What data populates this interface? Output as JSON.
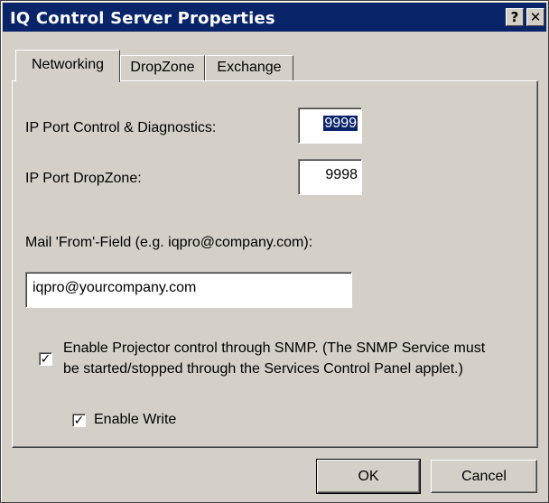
{
  "window": {
    "title": "IQ Control Server Properties",
    "help_glyph": "?",
    "close_glyph": "✕"
  },
  "tabs": [
    {
      "label": "Networking",
      "active": true
    },
    {
      "label": "DropZone",
      "active": false
    },
    {
      "label": "Exchange",
      "active": false
    }
  ],
  "networking": {
    "port_control_label": "IP Port Control & Diagnostics:",
    "port_control_value": "9999",
    "port_dropzone_label": "IP Port DropZone:",
    "port_dropzone_value": "9998",
    "mail_from_label": "Mail 'From'-Field (e.g. iqpro@company.com):",
    "mail_from_value": "iqpro@yourcompany.com",
    "snmp_checkbox_line1": "Enable Projector control through SNMP. (The SNMP Service must",
    "snmp_checkbox_line2": "be started/stopped through the Services Control Panel applet.)",
    "snmp_checked": true,
    "enable_write_label": "Enable Write",
    "enable_write_checked": true
  },
  "buttons": {
    "ok_label": "OK",
    "cancel_label": "Cancel"
  },
  "colors": {
    "titlebar": "#0a246a",
    "face": "#d4d0c8",
    "selection": "#0a246a"
  }
}
